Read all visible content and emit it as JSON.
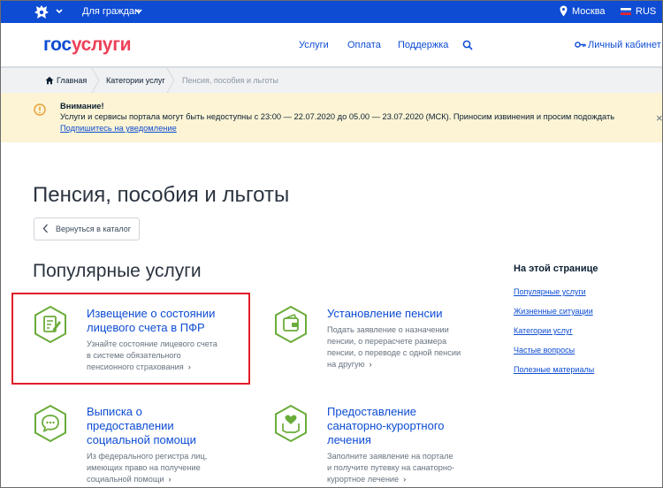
{
  "topbar": {
    "for_citizens": "Для граждан",
    "city": "Москва",
    "lang": "RUS"
  },
  "header": {
    "logo_part1": "гос",
    "logo_part2": "услуги",
    "nav": [
      "Услуги",
      "Оплата",
      "Поддержка"
    ],
    "cabinet": "Личный кабинет"
  },
  "breadcrumbs": [
    "Главная",
    "Категории услуг",
    "Пенсия, пособия и льготы"
  ],
  "alert": {
    "title": "Внимание!",
    "message": "Услуги и сервисы портала могут быть недоступны с 23:00 — 22.07.2020 до 05.00 — 23.07.2020 (МСК). Приносим извинения и просим подождать",
    "subscribe": "Подпишитесь на уведомление",
    "close": "×"
  },
  "page_title": "Пенсия, пособия и льготы",
  "back_button": "Вернуться в каталог",
  "popular_title": "Популярные услуги",
  "cards": [
    {
      "title": [
        "Извещение о состоянии",
        "лицевого счета в ПФР"
      ],
      "desc": [
        "Узнайте состояние лицевого счета",
        "в системе обязательного",
        "пенсионного страхования"
      ],
      "icon": "document-edit-icon"
    },
    {
      "title": [
        "Установление пенсии"
      ],
      "desc": [
        "Подать заявление о назначении",
        "пенсии, о перерасчете размера",
        "пенсии, о переводе с одной пенсии",
        "на другую"
      ],
      "icon": "wallet-icon"
    },
    {
      "title": [
        "Выписка о",
        "предоставлении",
        "социальной помощи"
      ],
      "desc": [
        "Из федерального регистра лиц,",
        "имеющих право на получение",
        "социальной помощи"
      ],
      "icon": "chat-bubble-icon"
    },
    {
      "title": [
        "Предоставление",
        "санаторно-курортного",
        "лечения"
      ],
      "desc": [
        "Заполните заявление на портале",
        "и получите путевку на санаторно-",
        "курортное лечение"
      ],
      "icon": "heart-hands-icon"
    }
  ],
  "toc": {
    "title": "На этой странице",
    "items": [
      "Популярные услуги",
      "Жизненные ситуации",
      "Категории услуг",
      "Частые вопросы",
      "Полезные материалы"
    ]
  },
  "colors": {
    "brand_blue": "#0d4cd3",
    "logo_red": "#ee3f58",
    "icon_green": "#6aac3a",
    "alert_bg": "#fcf4d4",
    "highlight": "#e11d2a"
  }
}
